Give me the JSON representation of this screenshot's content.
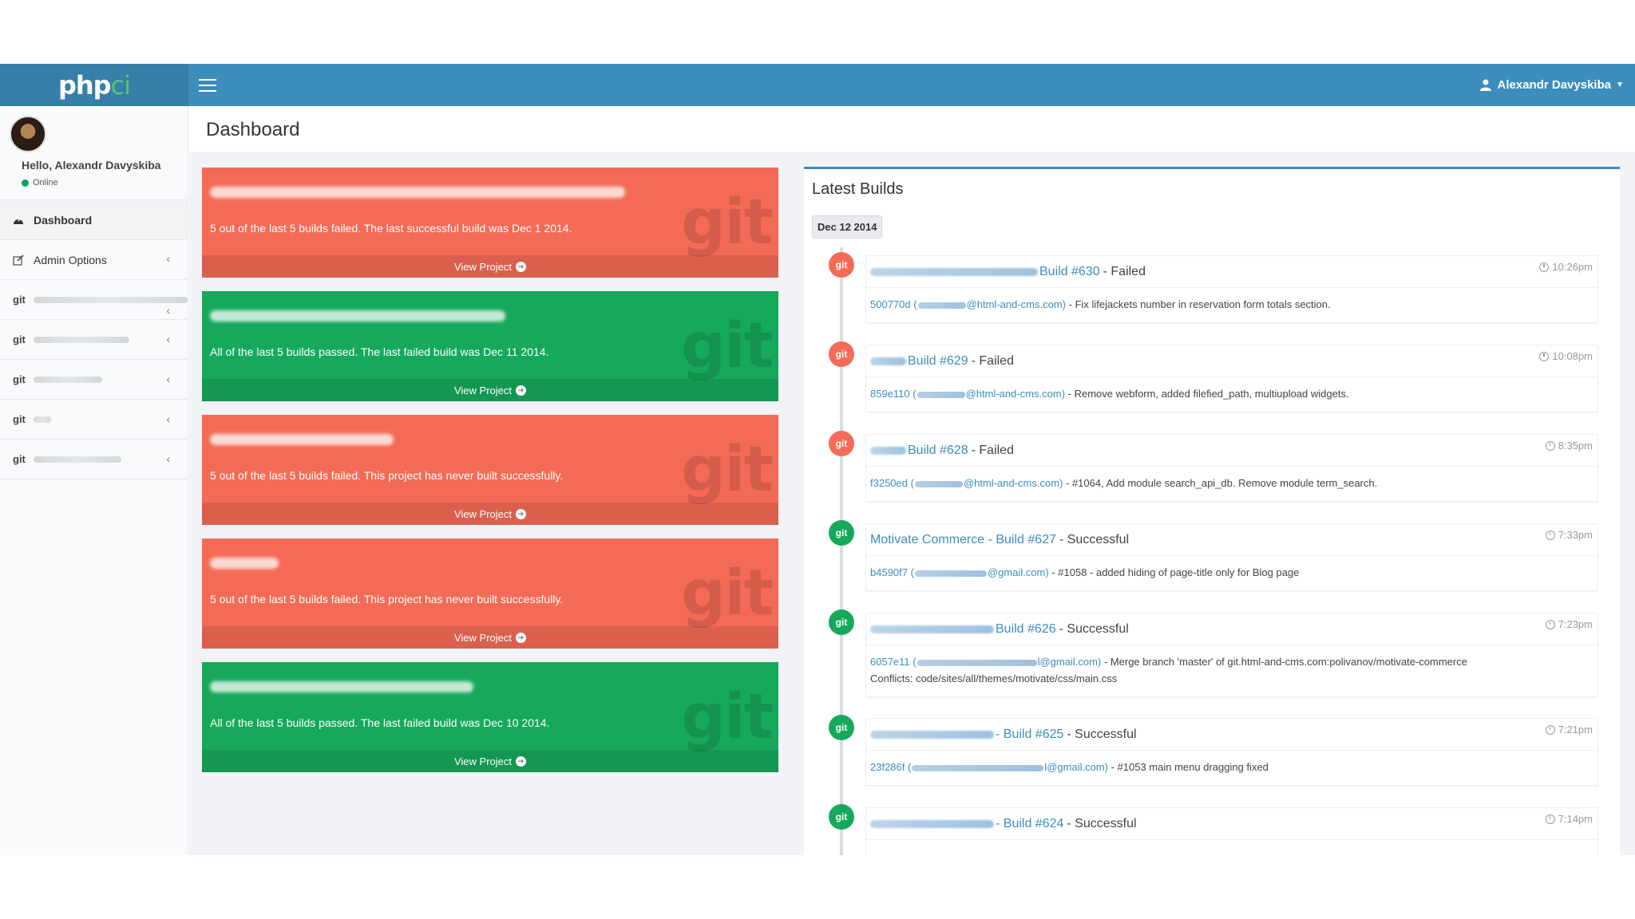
{
  "header": {
    "logo_main": "php",
    "logo_suffix": "ci",
    "user_name": "Alexandr Davyskiba"
  },
  "sidebar": {
    "greeting": "Hello, Alexandr Davyskiba",
    "status": "Online",
    "items": [
      {
        "label": "Dashboard",
        "icon": "dashboard-icon"
      },
      {
        "label": "Admin Options",
        "icon": "edit-icon"
      }
    ],
    "git_label": "git"
  },
  "content": {
    "page_title": "Dashboard"
  },
  "projects": [
    {
      "status": "failed",
      "message": "5 out of the last 5 builds failed. The last successful build was Dec 1 2014.",
      "link": "View Project"
    },
    {
      "status": "passed",
      "message": "All of the last 5 builds passed. The last failed build was Dec 11 2014.",
      "link": "View Project"
    },
    {
      "status": "failed",
      "message": "5 out of the last 5 builds failed. This project has never built successfully.",
      "link": "View Project"
    },
    {
      "status": "failed",
      "message": "5 out of the last 5 builds failed. This project has never built successfully.",
      "link": "View Project"
    },
    {
      "status": "passed",
      "message": "All of the last 5 builds passed. The last failed build was Dec 10 2014.",
      "link": "View Project"
    }
  ],
  "project_icon_text": "git",
  "latest_builds": {
    "title": "Latest Builds",
    "date": "Dec 12 2014",
    "icon_text": "git",
    "builds": [
      {
        "title": "Build #630",
        "status": "- Failed",
        "time": "10:26pm",
        "hash": "500770d (",
        "email": "@html-and-cms.com)",
        "message": "- Fix lifejackets number in reservation form totals section.",
        "message2": ""
      },
      {
        "title": "Build #629",
        "status": "- Failed",
        "time": "10:08pm",
        "hash": "859e110 (",
        "email": "@html-and-cms.com)",
        "message": "- Remove webform, added filefied_path, multiupload widgets.",
        "message2": ""
      },
      {
        "title": "Build #628",
        "status": "- Failed",
        "time": "8:35pm",
        "hash": "f3250ed (",
        "email": "@html-and-cms.com)",
        "message": "- #1064, Add module search_api_db. Remove module term_search.",
        "message2": ""
      },
      {
        "title": "Motivate Commerce - Build #627",
        "status": "- Successful",
        "time": "7:33pm",
        "hash": "b4590f7 (",
        "email": "@gmail.com)",
        "message": "- #1058 - added hiding of page-title only for Blog page",
        "message2": ""
      },
      {
        "title": "Build #626",
        "status": "- Successful",
        "time": "7:23pm",
        "hash": "6057e11 (",
        "email": "l@gmail.com)",
        "message": "- Merge branch 'master' of git.html-and-cms.com:polivanov/motivate-commerce",
        "message2": "Conflicts: code/sites/all/themes/motivate/css/main.css"
      },
      {
        "title": "- Build #625",
        "status": "- Successful",
        "time": "7:21pm",
        "hash": "23f286f (",
        "email": "l@gmail.com)",
        "message": "- #1053 main menu dragging fixed",
        "message2": ""
      },
      {
        "title": "- Build #624",
        "status": "- Successful",
        "time": "7:14pm",
        "hash": "",
        "email": "",
        "message": "",
        "message2": ""
      }
    ]
  },
  "colors": {
    "header_blue": "#3c8dbc",
    "failed_red": "#f36b56",
    "passed_green": "#16a95b"
  }
}
